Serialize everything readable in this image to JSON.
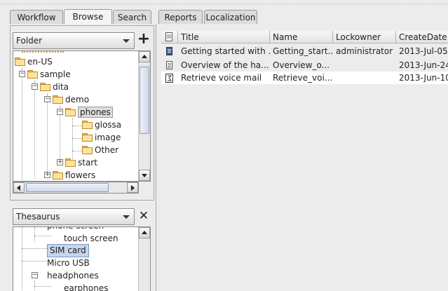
{
  "tabs": {
    "left": [
      "Workflow",
      "Browse",
      "Search"
    ],
    "right": [
      "Reports",
      "Localization"
    ],
    "active": "Browse"
  },
  "folder_panel": {
    "combo_value": "Folder",
    "add_label": "+",
    "tree": [
      {
        "label": "en-US"
      },
      {
        "label": "sample"
      },
      {
        "label": "dita"
      },
      {
        "label": "demo"
      },
      {
        "label": "phones"
      },
      {
        "label": "glossa"
      },
      {
        "label": "image"
      },
      {
        "label": "Other"
      },
      {
        "label": "start"
      },
      {
        "label": "flowers"
      }
    ]
  },
  "thesaurus_panel": {
    "combo_value": "Thesaurus",
    "close_label": "✕",
    "tree": [
      {
        "label": "phone screen"
      },
      {
        "label": "touch screen"
      },
      {
        "label": "SIM card"
      },
      {
        "label": "Micro USB"
      },
      {
        "label": "headphones"
      },
      {
        "label": "earphones"
      }
    ]
  },
  "table": {
    "columns": [
      "Title",
      "Name",
      "Lockowner",
      "CreateDate"
    ],
    "rows": [
      {
        "title": "Getting started with ...",
        "name": "Getting_start...",
        "lockowner": "administrator",
        "created": "2013-Jul-05",
        "icon": "dark-document-icon"
      },
      {
        "title": "Overview of the  ha...",
        "name": "Overview_o...",
        "lockowner": "",
        "created": "2013-Jun-24",
        "icon": "document-icon"
      },
      {
        "title": "Retrieve voice mail",
        "name": "Retrieve_voi...",
        "lockowner": "",
        "created": "2013-Jun-10",
        "icon": "task-document-icon"
      }
    ]
  },
  "colors": {
    "selection": "#c5d5ec",
    "selection_border": "#7d97c2",
    "background": "#ececec"
  }
}
